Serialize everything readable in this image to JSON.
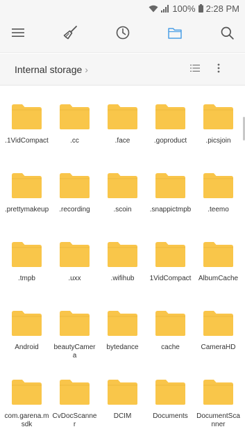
{
  "status_bar": {
    "battery": "100%",
    "time": "2:28 PM"
  },
  "toolbar": {
    "icons": [
      "menu-icon",
      "clean-icon",
      "recent-clock-icon",
      "folder-icon",
      "search-icon"
    ],
    "accent": "#4b9fe6"
  },
  "path": {
    "label": "Internal storage"
  },
  "folder_color": "#f9c54a",
  "folders": [
    ".1VidCompact",
    ".cc",
    ".face",
    ".goproduct",
    ".picsjoin",
    ".prettymakeup",
    ".recording",
    ".scoin",
    ".snappictmpb",
    ".teemo",
    ".tmpb",
    ".uxx",
    ".wifihub",
    "1VidCompact",
    "AlbumCache",
    "Android",
    "beautyCamera",
    "bytedance",
    "cache",
    "CameraHD",
    "com.garena.msdk",
    "CvDocScanner",
    "DCIM",
    "Documents",
    "DocumentScanner"
  ]
}
